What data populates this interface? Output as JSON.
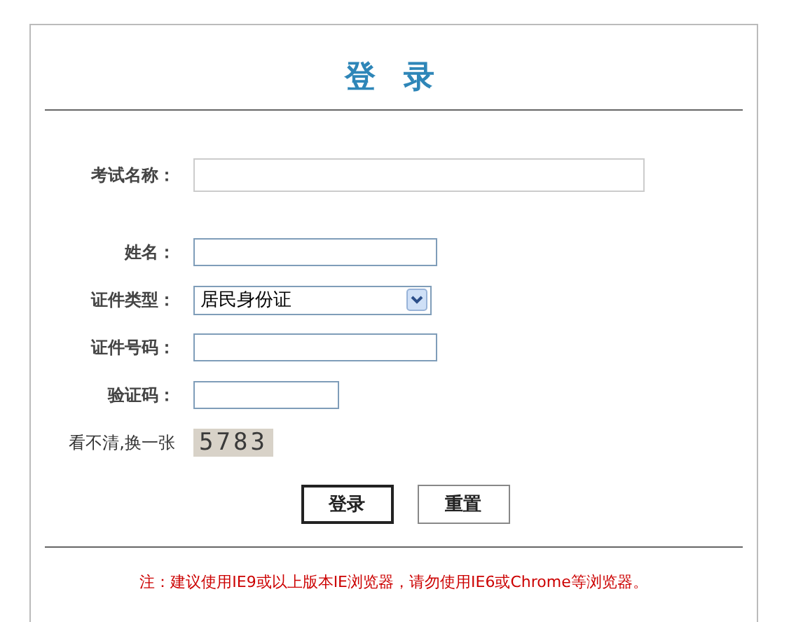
{
  "title": "登 录",
  "fields": [
    {
      "label": "考试名称：",
      "kind": "wide"
    },
    {
      "label": "姓名：",
      "kind": "text"
    },
    {
      "label": "证件类型：",
      "kind": "select",
      "value": "居民身份证"
    },
    {
      "label": "证件号码：",
      "kind": "text"
    },
    {
      "label": "验证码：",
      "kind": "short"
    }
  ],
  "captcha": {
    "refresh_link": "看不清,换一张",
    "code": "5783"
  },
  "buttons": [
    {
      "label": "登录",
      "focused": true
    },
    {
      "label": "重置",
      "focused": false
    }
  ],
  "note": "注：建议使用IE9或以上版本IE浏览器，请勿使用IE6或Chrome等浏览器。"
}
